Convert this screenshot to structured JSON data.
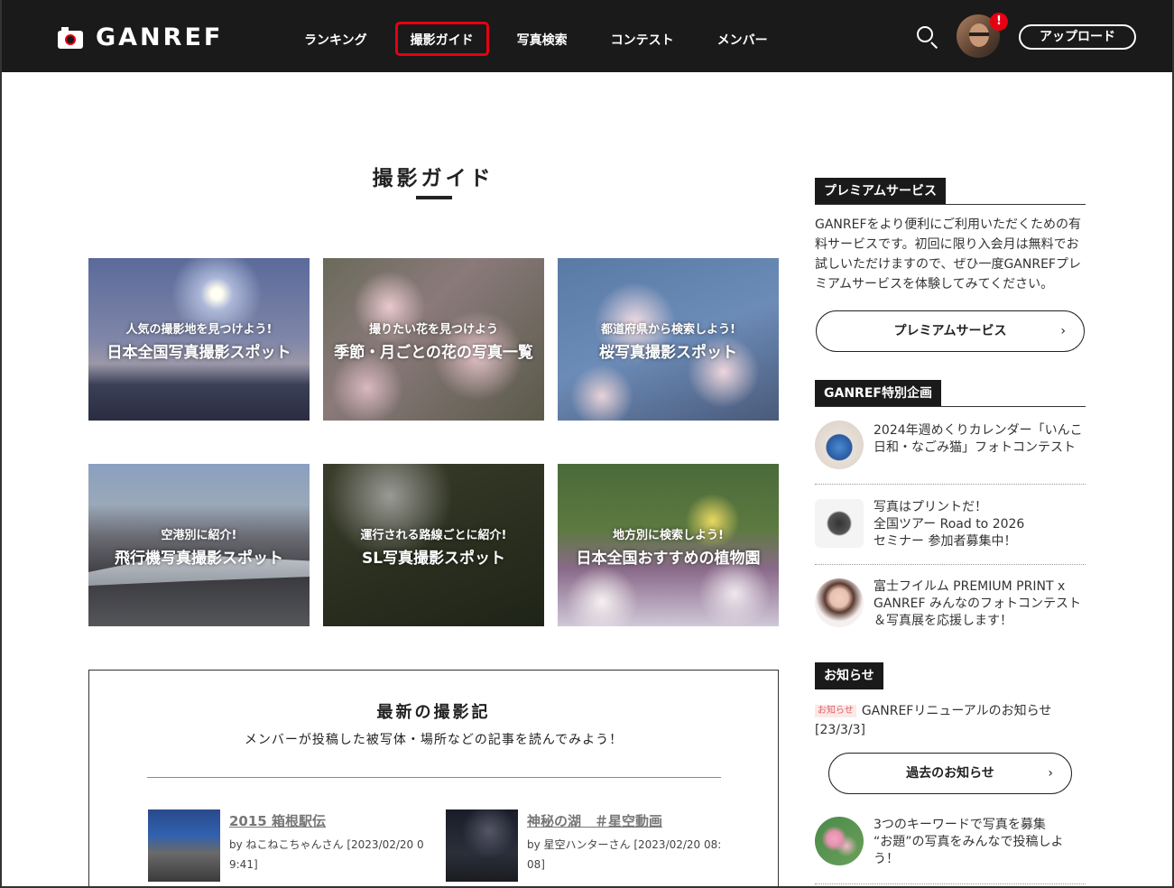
{
  "header": {
    "logo_text": "GANREF",
    "nav": [
      "ランキング",
      "撮影ガイド",
      "写真検索",
      "コンテスト",
      "メンバー"
    ],
    "active_nav": "撮影ガイド",
    "notification_badge": "!",
    "upload_label": "アップロード"
  },
  "main": {
    "title": "撮影ガイド",
    "tiles": [
      {
        "sub": "人気の撮影地を見つけよう!",
        "title": "日本全国写真撮影スポット"
      },
      {
        "sub": "撮りたい花を見つけよう",
        "title": "季節・月ごとの花の写真一覧"
      },
      {
        "sub": "都道府県から検索しよう!",
        "title": "桜写真撮影スポット"
      },
      {
        "sub": "空港別に紹介!",
        "title": "飛行機写真撮影スポット"
      },
      {
        "sub": "運行される路線ごとに紹介!",
        "title": "SL写真撮影スポット"
      },
      {
        "sub": "地方別に検索しよう!",
        "title": "日本全国おすすめの植物園"
      }
    ],
    "records": {
      "title": "最新の撮影記",
      "subtitle": "メンバーが投稿した被写体・場所などの記事を読んでみよう！",
      "items": [
        {
          "title": "2015 箱根駅伝",
          "meta": "by ねこねこちゃんさん [2023/02/20 09:41]"
        },
        {
          "title": "神秘の湖　＃星空動画",
          "meta": "by 星空ハンターさん [2023/02/20 08:08]"
        }
      ]
    }
  },
  "sidebar": {
    "premium": {
      "label": "プレミアムサービス",
      "text": "GANREFをより便利にご利用いただくための有料サービスです。初回に限り入会月は無料でお試しいただけますので、ぜひ一度GANREFプレミアムサービスを体験してみてください。",
      "button": "プレミアムサービス"
    },
    "special": {
      "label": "GANREF特別企画",
      "items": [
        "2024年週めくりカレンダー「いんこ日和・なごみ猫」フォトコンテスト",
        "写真はプリントだ！\n全国ツアー Road to 2026\nセミナー 参加者募集中！",
        "富士フイルム PREMIUM PRINT x GANREF みんなのフォトコンテスト＆写真展を応援します！"
      ]
    },
    "news": {
      "label": "お知らせ",
      "tag": "お知らせ",
      "text": "GANREFリニューアルのお知らせ",
      "date": "[23/3/3]",
      "button": "過去のお知らせ"
    },
    "theme_item": "3つのキーワードで写真を募集\n“お題”の写真をみんなで投稿しよう！",
    "chevron": "›"
  }
}
